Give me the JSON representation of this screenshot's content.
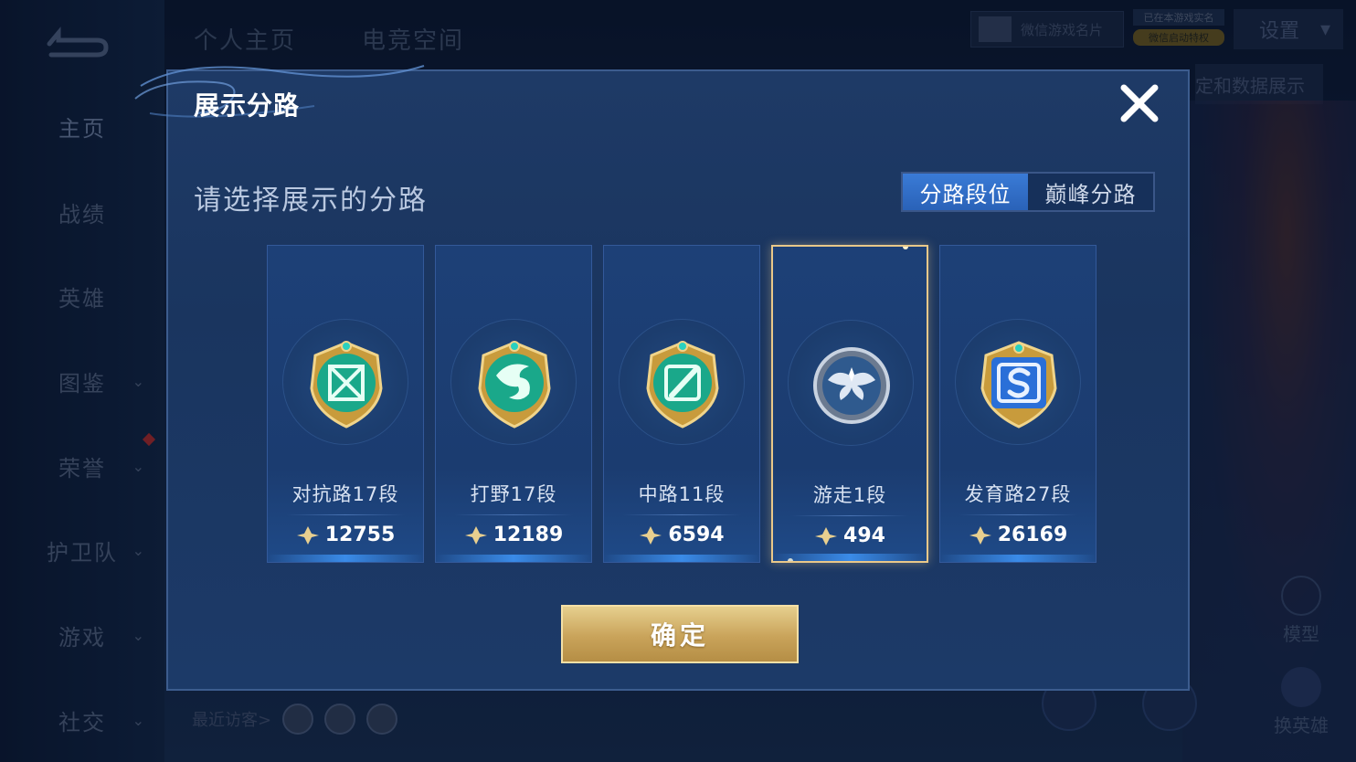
{
  "background": {
    "sidebar": [
      {
        "label": "主页",
        "active": true,
        "has_chevron": false
      },
      {
        "label": "战绩",
        "active": false,
        "has_chevron": false
      },
      {
        "label": "英雄",
        "active": false,
        "has_chevron": false
      },
      {
        "label": "图鉴",
        "active": false,
        "has_chevron": true
      },
      {
        "label": "荣誉",
        "active": false,
        "has_chevron": true
      },
      {
        "label": "护卫队",
        "active": false,
        "has_chevron": true
      },
      {
        "label": "游戏",
        "active": false,
        "has_chevron": true
      },
      {
        "label": "社交",
        "active": false,
        "has_chevron": true
      }
    ],
    "top_tabs": [
      "个人主页",
      "电竞空间"
    ],
    "wechat_card": "微信游戏名片",
    "sync_top": "已在本游戏实名",
    "sync_bottom": "微信启动特权",
    "settings": "设置",
    "data_banner": "定和数据展示",
    "model_label": "模型",
    "swap_label": "换英雄",
    "visitors_label": "最近访客>"
  },
  "dialog": {
    "title": "展示分路",
    "subtitle": "请选择展示的分路",
    "toggle": [
      {
        "label": "分路段位",
        "active": true
      },
      {
        "label": "巅峰分路",
        "active": false
      }
    ],
    "cards": [
      {
        "label": "对抗路17段",
        "score": "12755",
        "badge": "sword-cross",
        "selected": false
      },
      {
        "label": "打野17段",
        "score": "12189",
        "badge": "dragon",
        "selected": false
      },
      {
        "label": "中路11段",
        "score": "6594",
        "badge": "staff",
        "selected": false
      },
      {
        "label": "游走1段",
        "score": "494",
        "badge": "wings",
        "selected": true
      },
      {
        "label": "发育路27段",
        "score": "26169",
        "badge": "bow-s",
        "selected": false
      }
    ],
    "confirm": "确定"
  },
  "colors": {
    "accent_blue": "#2a62b8",
    "gold": "#c9a35a",
    "selected_border": "#e9c889"
  }
}
